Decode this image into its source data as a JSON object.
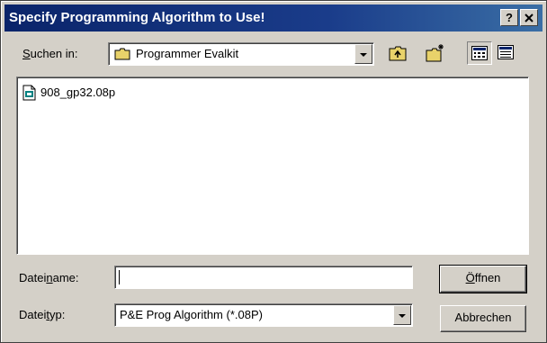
{
  "window": {
    "title": "Specify Programming Algorithm to Use!",
    "help_glyph": "?",
    "close_glyph": "✕"
  },
  "lookin": {
    "label_u": "S",
    "label_rest": "uchen in:",
    "value": "Programmer Evalkit"
  },
  "toolbar": {
    "up_icon": "up-folder-icon",
    "new_folder_icon": "new-folder-icon",
    "list_view_icon": "list-view-icon",
    "details_view_icon": "details-view-icon"
  },
  "files": [
    {
      "name": "908_gp32.08p",
      "icon": "document-icon"
    }
  ],
  "filename": {
    "label_pre": "Datei",
    "label_u": "n",
    "label_post": "ame:",
    "value": ""
  },
  "filetype": {
    "label_pre": "Datei",
    "label_u": "t",
    "label_post": "yp:",
    "value": "P&E Prog Algorithm (*.08P)"
  },
  "buttons": {
    "open_u": "Ö",
    "open_rest": "ffnen",
    "cancel": "Abbrechen"
  }
}
